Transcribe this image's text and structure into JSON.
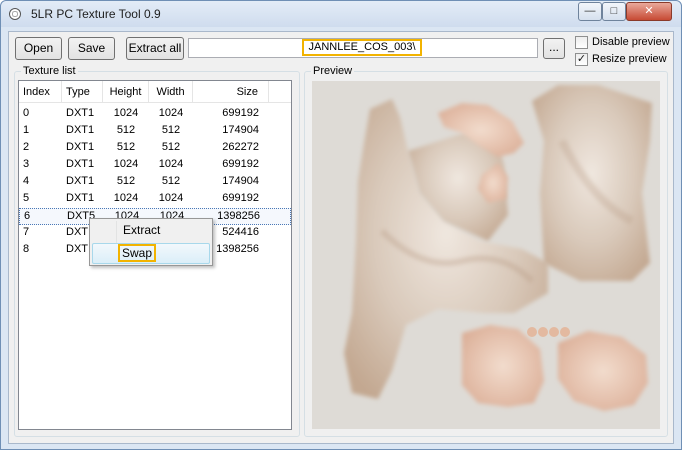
{
  "window": {
    "title": "5LR PC Texture Tool 0.9",
    "controls": {
      "minimize": "—",
      "maximize": "□",
      "close": "✕"
    }
  },
  "toolbar": {
    "open_label": "Open",
    "save_label": "Save",
    "extract_all_label": "Extract all",
    "path_value": "JANNLEE_COS_003\\",
    "browse_label": "...",
    "disable_preview": {
      "label": "Disable preview",
      "checked": false
    },
    "resize_preview": {
      "label": "Resize preview",
      "checked": true,
      "mark": "✓"
    }
  },
  "texture_list": {
    "group_label": "Texture list",
    "columns": [
      "Index",
      "Type",
      "Height",
      "Width",
      "Size"
    ],
    "rows": [
      [
        "0",
        "DXT1",
        "1024",
        "1024",
        "699192"
      ],
      [
        "1",
        "DXT1",
        "512",
        "512",
        "174904"
      ],
      [
        "2",
        "DXT1",
        "512",
        "512",
        "262272"
      ],
      [
        "3",
        "DXT1",
        "1024",
        "1024",
        "699192"
      ],
      [
        "4",
        "DXT1",
        "512",
        "512",
        "174904"
      ],
      [
        "5",
        "DXT1",
        "1024",
        "1024",
        "699192"
      ],
      [
        "6",
        "DXT5",
        "1024",
        "1024",
        "1398256"
      ],
      [
        "7",
        "DXT",
        "",
        "",
        "524416"
      ],
      [
        "8",
        "DXT",
        "",
        "",
        "1398256"
      ]
    ],
    "selected_index": 6
  },
  "context_menu": {
    "extract_label": "Extract",
    "swap_label": "Swap"
  },
  "preview": {
    "group_label": "Preview",
    "colors": {
      "background": "#dedbd6",
      "skin": "#e3b9a0",
      "fabric": "#d6c9bb",
      "shade": "#b79a83"
    }
  },
  "colors": {
    "highlight": "#f2b300",
    "window_bg": "#f0f0f0",
    "selection_border": "#4a78b6"
  }
}
